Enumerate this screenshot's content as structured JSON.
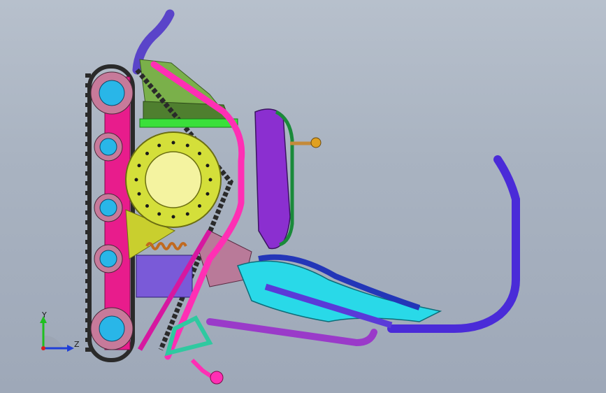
{
  "viewport": {
    "background_top": "#b7c0cc",
    "background_bottom": "#9ea8b8"
  },
  "triad": {
    "y_label": "Y",
    "z_label": "Z",
    "y_color": "#1fbf1f",
    "z_color": "#1f3fd8",
    "x_color": "#d81f1f"
  },
  "model": {
    "track_color": "#2a2a2a",
    "rail_color": "#e81c8c",
    "wheel_hub_color": "#29b6e8",
    "wheel_rim_color": "#c77a9a",
    "drum_color": "#d4df3a",
    "frame_tube_color": "#ff2fb4",
    "handle_bar_color": "#4a2bd8",
    "seat_color": "#8b2fd0",
    "ski_color": "#29d9e8",
    "bracket_color": "#6cae3a",
    "knob_color": "#e0a020"
  }
}
